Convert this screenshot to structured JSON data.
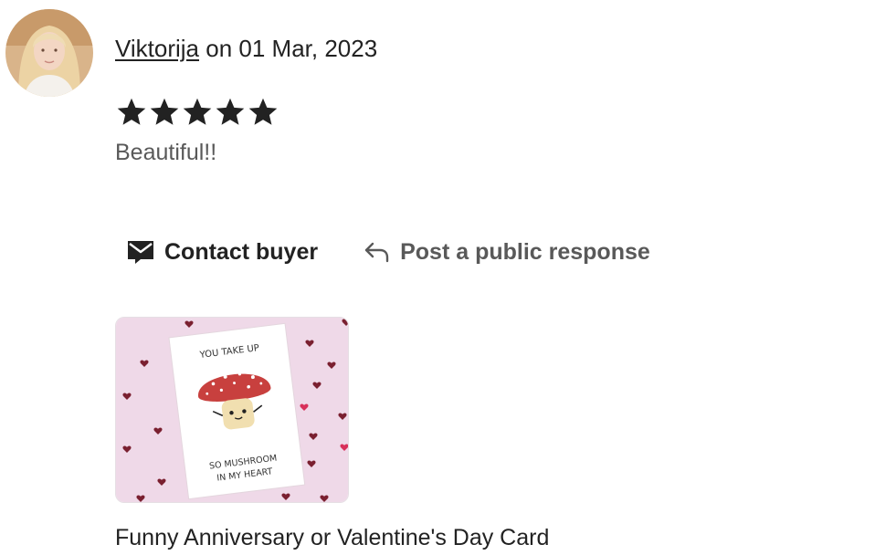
{
  "review": {
    "reviewer_name": "Viktorija",
    "date_text": "on 01 Mar, 2023",
    "rating": 5,
    "rating_max": 5,
    "text": "Beautiful!!"
  },
  "actions": {
    "contact_label": "Contact buyer",
    "contact_icon": "envelope-icon",
    "respond_label": "Post a public response",
    "respond_icon": "reply-arrow-icon"
  },
  "product": {
    "title": "Funny Anniversary or Valentine's Day Card",
    "card_text_top": "YOU TAKE UP",
    "card_text_bottom_1": "SO MUSHROOM",
    "card_text_bottom_2": "IN MY HEART"
  },
  "colors": {
    "text_primary": "#222222",
    "text_secondary": "#595959",
    "star": "#222222",
    "thumb_background": "#efd9e8",
    "mushroom_cap": "#c8403e"
  }
}
